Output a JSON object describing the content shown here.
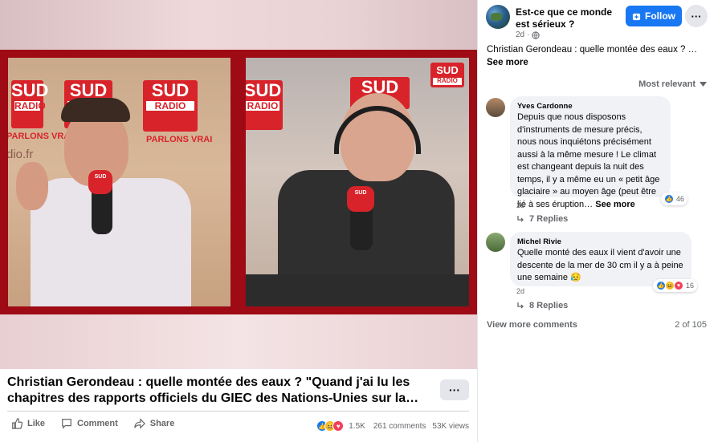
{
  "video": {
    "logo_top": "SUD",
    "logo_bottom": "RADIO",
    "tagline": "PARLONS VRAI",
    "site_fragment": "dio.fr"
  },
  "post": {
    "title": "Christian Gerondeau : quelle montée des eaux ? \"Quand j'ai lu les chapitres des rapports officiels du GIEC des Nations-Unies sur la…",
    "more_label": "···",
    "like_label": "Like",
    "comment_label": "Comment",
    "share_label": "Share",
    "reaction_count": "1.5K",
    "comments_count": "261 comments",
    "views_count": "53K views"
  },
  "panel": {
    "page_name": "Est-ce que ce monde est sérieux ?",
    "time": "2d",
    "follow_label": "Follow",
    "dots_label": "···",
    "post_text": "Christian Gerondeau : quelle montée des eaux ? …",
    "see_more": "See more",
    "sort_label": "Most relevant"
  },
  "comments": [
    {
      "author": "Yves Cardonne",
      "text": "Depuis que nous disposons d'instruments de mesure précis, nous nous inquiétons précisément aussi à la même mesure ! Le climat est changeant depuis la nuit des temps, il y a même eu un « petit âge glaciaire » au moyen âge (peut être lié à ses éruption…",
      "see_more": "See more",
      "reactions": "46",
      "time": "2d",
      "replies": "7 Replies"
    },
    {
      "author": "Michel Rivie",
      "text": "Quelle monté des eaux il vient d'avoir une descente de la mer de 30 cm il y a à peine une semaine",
      "emoji": "😥",
      "reactions": "16",
      "time": "2d",
      "replies": "8 Replies"
    }
  ],
  "footer": {
    "view_more": "View more comments",
    "count": "2 of 105"
  }
}
